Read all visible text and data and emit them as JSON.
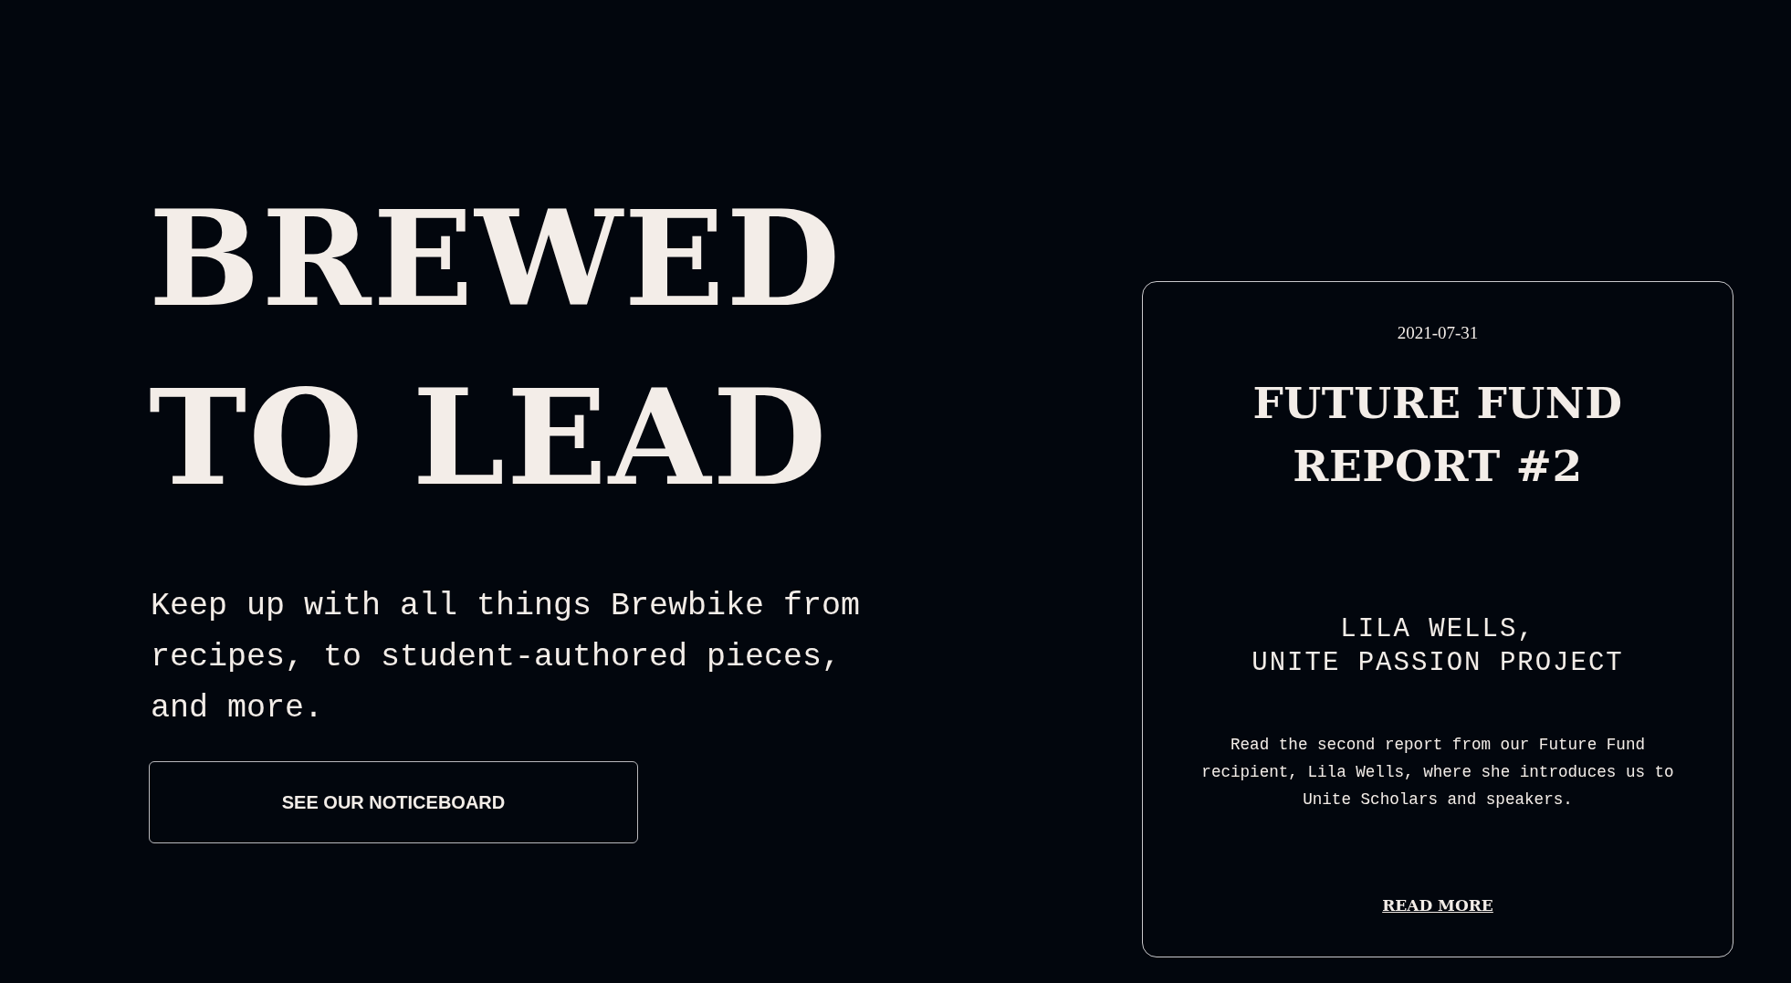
{
  "hero": {
    "headline": "BREWED TO LEAD",
    "intro": "Keep up with all things Brewbike from recipes, to student-authored pieces, and more.",
    "button": "SEE OUR NOTICEBOARD"
  },
  "featured_post": {
    "date": "2021-07-31",
    "title": "FUTURE FUND REPORT #2",
    "author_lines": [
      "LILA WELLS,",
      "UNITE PASSION PROJECT"
    ],
    "excerpt": "Read the second report from our Future Fund recipient, Lila Wells, where she introduces us to Unite Scholars and speakers.",
    "link": "READ MORE"
  }
}
